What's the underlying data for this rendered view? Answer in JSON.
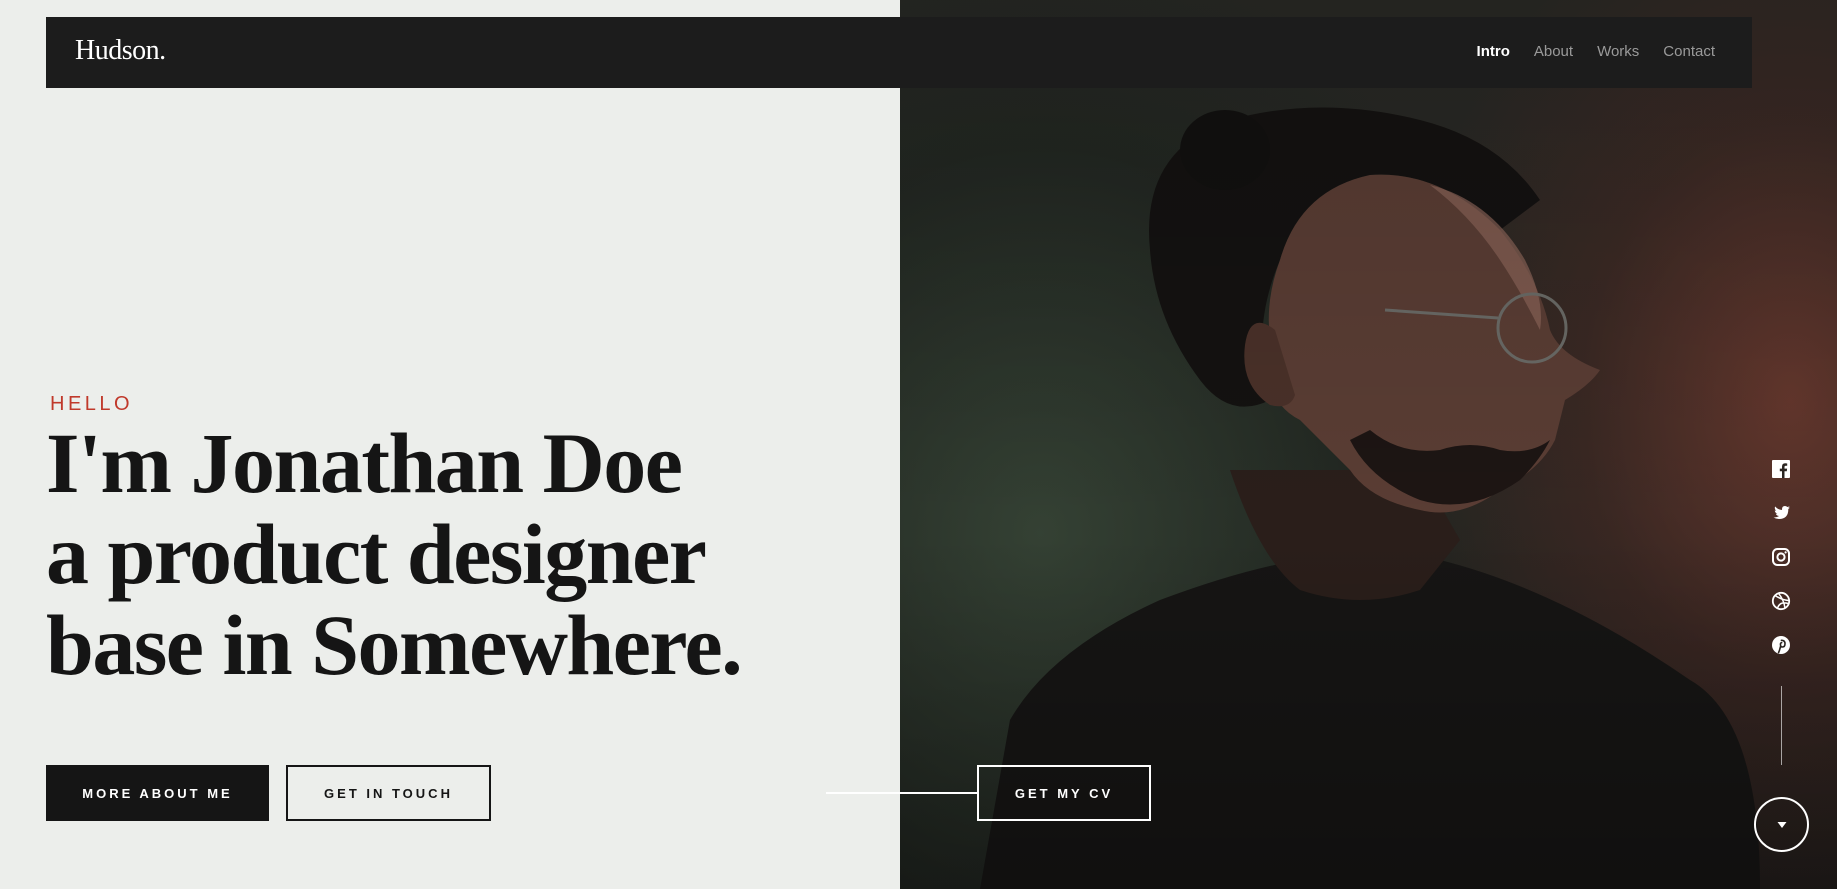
{
  "header": {
    "logo": "Hudson.",
    "nav": [
      {
        "label": "Intro",
        "active": true
      },
      {
        "label": "About",
        "active": false
      },
      {
        "label": "Works",
        "active": false
      },
      {
        "label": "Contact",
        "active": false
      }
    ]
  },
  "hero": {
    "eyebrow": "HELLO",
    "headline_lines": [
      "I'm Jonathan Doe",
      "a product designer",
      "base in Somewhere."
    ]
  },
  "buttons": {
    "more_about": "MORE ABOUT ME",
    "get_in_touch": "GET IN TOUCH",
    "get_cv": "GET MY CV"
  },
  "social": {
    "icons": [
      "facebook-icon",
      "twitter-icon",
      "instagram-icon",
      "dribbble-icon",
      "pinterest-icon"
    ]
  },
  "scroll_icon": "chevron-down-icon",
  "colors": {
    "background": "#eceeeb",
    "dark": "#151515",
    "header": "#1c1c1c",
    "accent": "#c0392b",
    "white": "#ffffff"
  }
}
